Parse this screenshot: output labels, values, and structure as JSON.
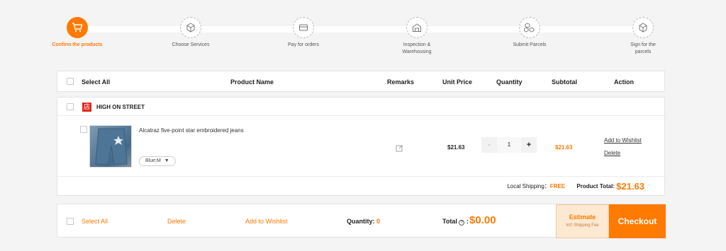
{
  "steps": [
    {
      "label": "Confirm the products",
      "icon": "cart-icon",
      "active": true
    },
    {
      "label": "Choose Services",
      "icon": "box-icon"
    },
    {
      "label": "Pay for orders",
      "icon": "card-icon"
    },
    {
      "label": "Inspection & Warehousing",
      "icon": "warehouse-icon"
    },
    {
      "label": "Submit Parcels",
      "icon": "parcels-icon"
    },
    {
      "label": "Sign for the parcels",
      "icon": "parcel-sign-icon"
    }
  ],
  "table_header": {
    "select_all": "Select All",
    "product_name": "Product Name",
    "remarks": "Remarks",
    "unit_price": "Unit Price",
    "quantity": "Quantity",
    "subtotal": "Subtotal",
    "action": "Action"
  },
  "store": {
    "badge": "店",
    "name": "HIGH ON STREET",
    "item": {
      "name": "Alcatraz five-point star embroidered jeans",
      "variant": "Blue;M",
      "unit_price": "$21.63",
      "qty_minus": "-",
      "quantity": "1",
      "qty_plus": "+",
      "subtotal": "$21.63",
      "add_to_wishlist": "Add to Wishlist",
      "delete": "Delete"
    },
    "local_shipping_label": "Local Shipping：",
    "local_shipping_value": "FREE",
    "product_total_label": "Product Total:",
    "product_total_value": "$21.63"
  },
  "bottom_bar": {
    "select_all": "Select All",
    "delete": "Delete",
    "add_to_wishlist": "Add to Wishlist",
    "quantity_label": "Quantity:",
    "quantity_value": "0",
    "total_label": "Total",
    "total_value": "$0.00",
    "estimate_title": "Estimate",
    "estimate_sub": "Int'l Shipping Fee",
    "checkout": "Checkout"
  },
  "colors": {
    "accent": "#ff7a00",
    "shop_badge": "#e0281b"
  }
}
